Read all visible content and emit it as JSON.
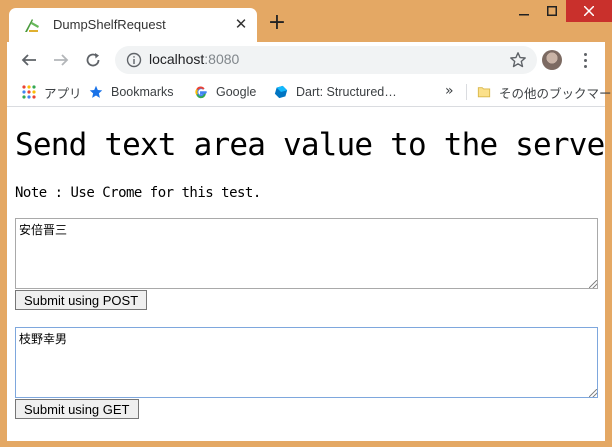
{
  "tab": {
    "title": "DumpShelfRequest",
    "close": "✕"
  },
  "new_tab": "+",
  "omnibox": {
    "host": "localhost",
    "port": ":8080"
  },
  "bookmarks": [
    {
      "label": "アプリ",
      "icon": "apps-grid-icon"
    },
    {
      "label": "Bookmarks",
      "icon": "star-icon"
    },
    {
      "label": "Google",
      "icon": "google-icon"
    },
    {
      "label": "Dart: Structured…",
      "icon": "dart-icon"
    }
  ],
  "bookmarks_more": "»",
  "other_bookmarks": {
    "label": "その他のブックマーク",
    "icon": "folder-icon"
  },
  "page": {
    "title": "Send text area value to the server",
    "note": "Note : Use Crome for this test.",
    "post_textarea_value": "安倍晋三",
    "post_button": "Submit using POST",
    "get_textarea_value": "枝野幸男",
    "get_button": "Submit using GET"
  },
  "colors": {
    "frame": "#e4a864",
    "close_button": "#c9302c",
    "focus_border": "#7ea7dd",
    "star_blue": "#1a73e8"
  }
}
